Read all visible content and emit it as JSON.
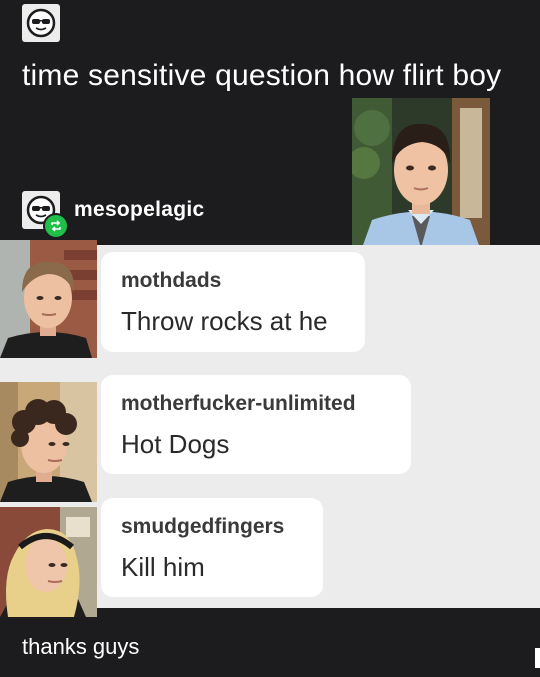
{
  "post": {
    "op_avatar_icon": "sunglasses-face-icon",
    "text": "time sensitive question how flirt boy"
  },
  "reblog": {
    "username": "mesopelagic",
    "badge_icon": "reblog-icon",
    "badge_color": "#1fbf4a"
  },
  "replies": [
    {
      "username": "mothdads",
      "text": "Throw rocks at he"
    },
    {
      "username": "motherfucker-unlimited",
      "text": "Hot Dogs"
    },
    {
      "username": "smudgedfingers",
      "text": "Kill him"
    }
  ],
  "footer": {
    "text": "thanks guys"
  },
  "colors": {
    "background": "#1c1c1e",
    "panel": "#ececec",
    "bubble": "#ffffff"
  }
}
